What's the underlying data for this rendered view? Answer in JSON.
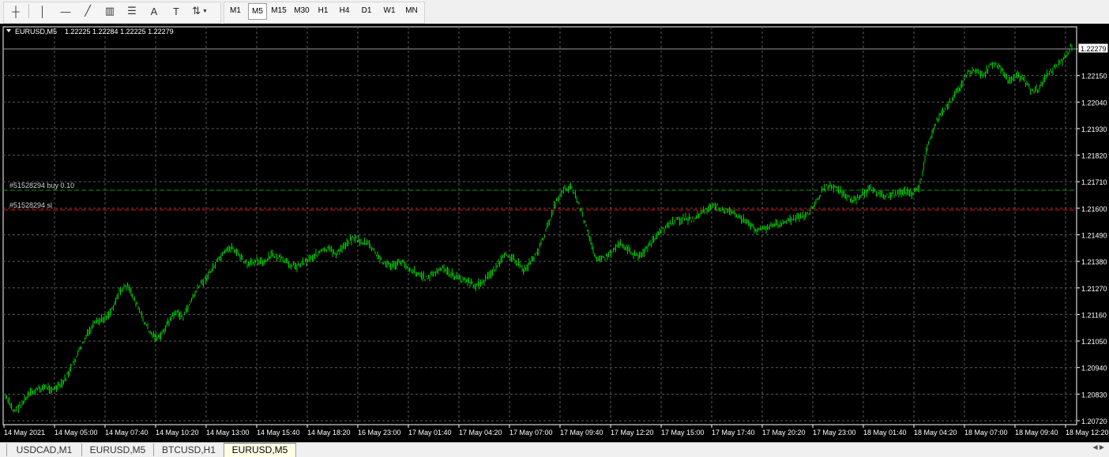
{
  "toolbar": {
    "tools": [
      {
        "name": "crosshair-icon",
        "glyph": "┼"
      },
      {
        "name": "vertical-line-icon",
        "glyph": "│"
      },
      {
        "name": "horizontal-line-icon",
        "glyph": "—"
      },
      {
        "name": "trendline-icon",
        "glyph": "╱"
      },
      {
        "name": "equidistant-channel-icon",
        "glyph": "▥"
      },
      {
        "name": "fibonacci-icon",
        "glyph": "☰"
      },
      {
        "name": "text-icon",
        "glyph": "A"
      },
      {
        "name": "text-label-icon",
        "glyph": "T"
      },
      {
        "name": "arrows-icon",
        "glyph": "⇅"
      }
    ],
    "timeframes": [
      "M1",
      "M5",
      "M15",
      "M30",
      "H1",
      "H4",
      "D1",
      "W1",
      "MN"
    ],
    "active_timeframe": "M5"
  },
  "chart": {
    "header_symbol": "EURUSD,M5",
    "header_prices": "1.22225 1.22284 1.22225 1.22279",
    "buy_label": "#51528294 buy 0.10",
    "sl_label": "#51528294 sl",
    "current_price_label": "1.22279",
    "colors": {
      "background": "#000000",
      "grid": "#5a5a5a",
      "candles": "#00c800",
      "buy_line": "#00a000",
      "sl_line": "#ff0000",
      "axis_text": "#ffffff"
    }
  },
  "chart_data": {
    "type": "line",
    "symbol": "EURUSD",
    "timeframe": "M5",
    "price_ticks": [
      "1.22279",
      "1.22150",
      "1.22040",
      "1.21930",
      "1.21820",
      "1.21710",
      "1.21600",
      "1.21490",
      "1.21380",
      "1.21270",
      "1.21160",
      "1.21050",
      "1.20940",
      "1.20830",
      "1.20720"
    ],
    "ylim": [
      1.207,
      1.2229
    ],
    "time_ticks": [
      "14 May 2021",
      "14 May 05:00",
      "14 May 07:40",
      "14 May 10:20",
      "14 May 13:00",
      "14 May 15:40",
      "14 May 18:20",
      "16 May 23:00",
      "17 May 01:40",
      "17 May 04:20",
      "17 May 07:00",
      "17 May 09:40",
      "17 May 12:20",
      "17 May 15:00",
      "17 May 17:40",
      "17 May 20:20",
      "17 May 23:00",
      "18 May 01:40",
      "18 May 04:20",
      "18 May 07:00",
      "18 May 09:40",
      "18 May 12:20"
    ],
    "buy_level": 1.2169,
    "sl_level": 1.21605,
    "current_price": 1.22279,
    "series": [
      {
        "values": [
          1.2082,
          1.2076,
          1.2079,
          1.2083,
          1.2085,
          1.2086,
          1.2085,
          1.2087,
          1.2093,
          1.21,
          1.2107,
          1.2112,
          1.2114,
          1.2117,
          1.2125,
          1.2128,
          1.2122,
          1.2114,
          1.2108,
          1.2106,
          1.2112,
          1.2117,
          1.2115,
          1.2122,
          1.2128,
          1.2132,
          1.2137,
          1.2141,
          1.2144,
          1.214,
          1.2136,
          1.2139,
          1.2137,
          1.2141,
          1.2139,
          1.2137,
          1.2136,
          1.2138,
          1.214,
          1.2142,
          1.2143,
          1.2141,
          1.2145,
          1.2148,
          1.2146,
          1.2145,
          1.214,
          1.2137,
          1.2136,
          1.2138,
          1.2135,
          1.2133,
          1.2131,
          1.2133,
          1.2135,
          1.2133,
          1.2131,
          1.213,
          1.2128,
          1.2129,
          1.2133,
          1.2137,
          1.2141,
          1.2139,
          1.2134,
          1.2138,
          1.2143,
          1.2152,
          1.2162,
          1.2168,
          1.2169,
          1.2161,
          1.215,
          1.214,
          1.2139,
          1.2142,
          1.2146,
          1.2143,
          1.214,
          1.2142,
          1.2146,
          1.215,
          1.2153,
          1.2155,
          1.2156,
          1.2155,
          1.2158,
          1.216,
          1.2161,
          1.2159,
          1.2158,
          1.2156,
          1.2153,
          1.2151,
          1.2152,
          1.2153,
          1.2154,
          1.2155,
          1.2156,
          1.2157,
          1.2161,
          1.2167,
          1.217,
          1.2168,
          1.2165,
          1.2163,
          1.2166,
          1.2168,
          1.2166,
          1.2165,
          1.2166,
          1.2167,
          1.2166,
          1.2168,
          1.2185,
          1.2195,
          1.22,
          1.2205,
          1.221,
          1.2216,
          1.2217,
          1.2215,
          1.222,
          1.2218,
          1.2213,
          1.2215,
          1.2213,
          1.2208,
          1.221,
          1.2216,
          1.2219,
          1.2222,
          1.2228
        ]
      }
    ]
  },
  "tabs": [
    {
      "label": "USDCAD,M1"
    },
    {
      "label": "EURUSD,M5"
    },
    {
      "label": "BTCUSD,H1"
    },
    {
      "label": "EURUSD,M5"
    }
  ],
  "active_tab": 3
}
